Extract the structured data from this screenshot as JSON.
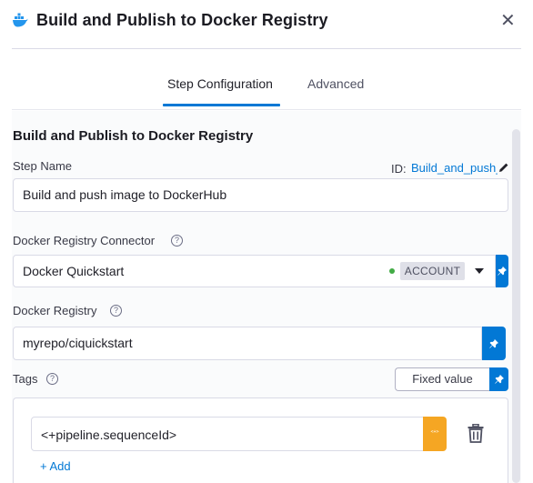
{
  "header": {
    "title": "Build and Publish to Docker Registry",
    "logo_icon": "docker-icon",
    "close_glyph": "✕"
  },
  "tabs": [
    {
      "label": "Step Configuration",
      "active": true
    },
    {
      "label": "Advanced",
      "active": false
    }
  ],
  "form": {
    "section_title": "Build and Publish to Docker Registry",
    "step_name": {
      "label": "Step Name",
      "id_label": "ID:",
      "id_value": "Build_and_push_image_to_DockerHub",
      "value": "Build and push image to DockerHub"
    },
    "connector": {
      "label": "Docker Registry Connector",
      "value": "Docker Quickstart",
      "scope": "ACCOUNT",
      "status_color": "#42ab45"
    },
    "registry": {
      "label": "Docker Registry",
      "value": "myrepo/ciquickstart"
    },
    "tags": {
      "label": "Tags",
      "mode_label": "Fixed value",
      "items": [
        "<+pipeline.sequenceId>"
      ],
      "add_label": "+ Add"
    }
  },
  "colors": {
    "accent": "#0278d5",
    "expression": "#f5a623"
  }
}
